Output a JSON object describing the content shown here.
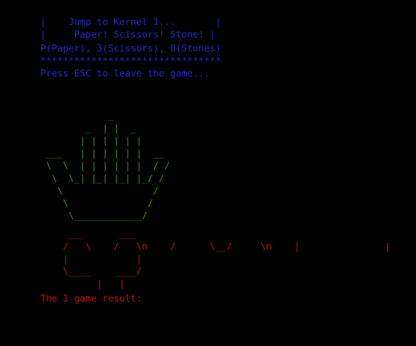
{
  "header": {
    "lines": [
      "|    Jump to Kernel 1...       |",
      "|     Paper! Scissors! Stone! |",
      "P(Paper), 3(Scissors), 0(Stones)",
      "********************************",
      "Press ESC to leave the game..."
    ]
  },
  "player_art": {
    "lines": [
      "            _",
      "        _  | |  _",
      "       | | | | | |",
      " ___   | | | | | |  __",
      " \\  \\  | | | | | |  / /",
      "  \\  \\_| |_| |_| |_/ /",
      "   \\                /",
      "    \\              /",
      "     \\____________/"
    ]
  },
  "computer_art": {
    "lines": [
      "     ___      ___",
      "    /   \\    /   \\n    /      \\__/     \\n    |               |",
      "    |            |",
      "    \\____    ____/",
      "          |   |"
    ]
  },
  "result": {
    "label": "The 1 game result:"
  },
  "colors": {
    "background": "#000000",
    "header_text": "#2a2ad6",
    "player_art": "#3c9a28",
    "computer_art": "#c41818",
    "result_text": "#c41818"
  }
}
